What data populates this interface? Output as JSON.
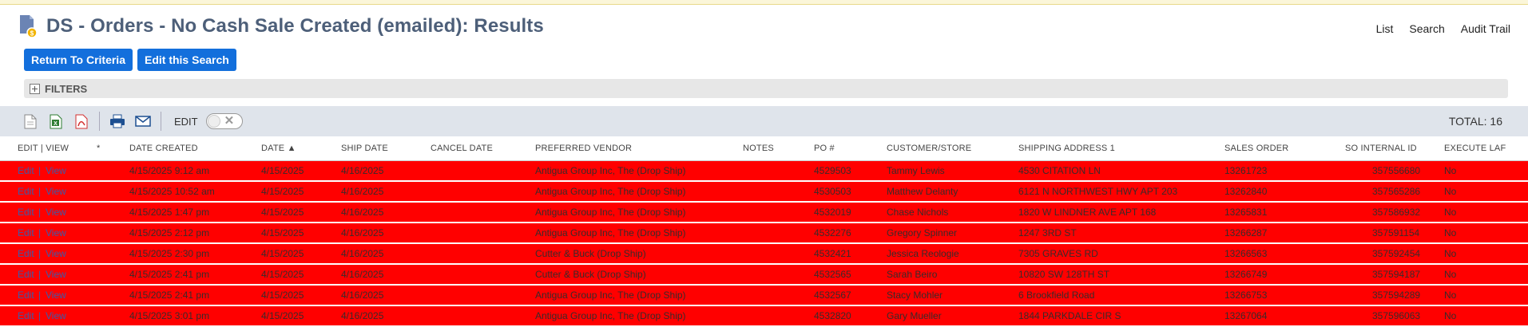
{
  "page": {
    "title": "DS - Orders - No Cash Sale Created (emailed): Results",
    "top_links": [
      "List",
      "Search",
      "Audit Trail"
    ],
    "buttons": {
      "return": "Return To Criteria",
      "edit_search": "Edit this Search"
    },
    "filters_label": "FILTERS",
    "edit_label": "EDIT",
    "total": "TOTAL: 16"
  },
  "colors": {
    "row_highlight": "#ff0000",
    "button": "#136fdc",
    "title": "#4d5f79",
    "toolbar": "#dfe4eb"
  },
  "table": {
    "columns": [
      "EDIT | VIEW",
      "*",
      "DATE CREATED",
      "DATE ▲",
      "SHIP DATE",
      "CANCEL DATE",
      "PREFERRED VENDOR",
      "NOTES",
      "PO #",
      "CUSTOMER/STORE",
      "SHIPPING ADDRESS 1",
      "SALES ORDER",
      "SO INTERNAL ID",
      "EXECUTE LAF"
    ],
    "rows": [
      {
        "edit": "Edit",
        "view": "View",
        "created": "4/15/2025 9:12 am",
        "date": "4/15/2025",
        "ship": "4/16/2025",
        "vendor": "Antigua Group Inc, The (Drop Ship)",
        "po": "4529503",
        "customer": "Tammy Lewis",
        "address": "4530 CITATION LN",
        "so": "13261723",
        "internal": "357556680",
        "laf": "No"
      },
      {
        "edit": "Edit",
        "view": "View",
        "created": "4/15/2025 10:52 am",
        "date": "4/15/2025",
        "ship": "4/16/2025",
        "vendor": "Antigua Group Inc, The (Drop Ship)",
        "po": "4530503",
        "customer": "Matthew Delanty",
        "address": "6121 N NORTHWEST HWY APT 203",
        "so": "13262840",
        "internal": "357565286",
        "laf": "No"
      },
      {
        "edit": "Edit",
        "view": "View",
        "created": "4/15/2025 1:47 pm",
        "date": "4/15/2025",
        "ship": "4/16/2025",
        "vendor": "Antigua Group Inc, The (Drop Ship)",
        "po": "4532019",
        "customer": "Chase Nichols",
        "address": "1820 W LINDNER AVE APT 168",
        "so": "13265831",
        "internal": "357586932",
        "laf": "No"
      },
      {
        "edit": "Edit",
        "view": "View",
        "created": "4/15/2025 2:12 pm",
        "date": "4/15/2025",
        "ship": "4/16/2025",
        "vendor": "Antigua Group Inc, The (Drop Ship)",
        "po": "4532276",
        "customer": "Gregory Spinner",
        "address": "1247 3RD ST",
        "so": "13266287",
        "internal": "357591154",
        "laf": "No"
      },
      {
        "edit": "Edit",
        "view": "View",
        "created": "4/15/2025 2:30 pm",
        "date": "4/15/2025",
        "ship": "4/16/2025",
        "vendor": "Cutter & Buck (Drop Ship)",
        "po": "4532421",
        "customer": "Jessica Reologie",
        "address": "7305 GRAVES RD",
        "so": "13266563",
        "internal": "357592454",
        "laf": "No"
      },
      {
        "edit": "Edit",
        "view": "View",
        "created": "4/15/2025 2:41 pm",
        "date": "4/15/2025",
        "ship": "4/16/2025",
        "vendor": "Cutter & Buck (Drop Ship)",
        "po": "4532565",
        "customer": "Sarah Beiro",
        "address": "10820 SW 128TH ST",
        "so": "13266749",
        "internal": "357594187",
        "laf": "No"
      },
      {
        "edit": "Edit",
        "view": "View",
        "created": "4/15/2025 2:41 pm",
        "date": "4/15/2025",
        "ship": "4/16/2025",
        "vendor": "Antigua Group Inc, The (Drop Ship)",
        "po": "4532567",
        "customer": "Stacy Mohler",
        "address": "6 Brookfield Road",
        "so": "13266753",
        "internal": "357594289",
        "laf": "No"
      },
      {
        "edit": "Edit",
        "view": "View",
        "created": "4/15/2025 3:01 pm",
        "date": "4/15/2025",
        "ship": "4/16/2025",
        "vendor": "Antigua Group Inc, The (Drop Ship)",
        "po": "4532820",
        "customer": "Gary Mueller",
        "address": "1844 PARKDALE CIR S",
        "so": "13267064",
        "internal": "357596063",
        "laf": "No"
      }
    ]
  }
}
